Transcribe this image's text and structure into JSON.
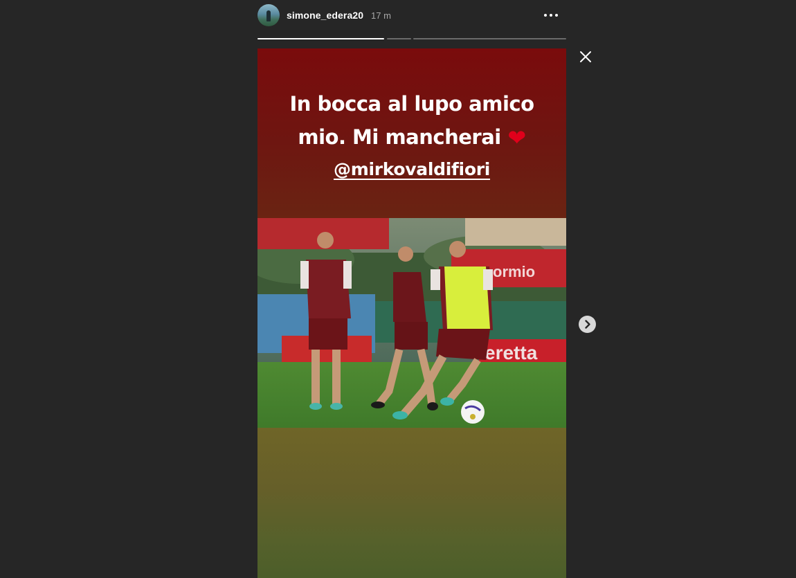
{
  "header": {
    "username": "simone_edera20",
    "timestamp": "17 m",
    "avatar_icon": "profile-avatar",
    "more_icon": "more-options-icon"
  },
  "progress": {
    "segments": [
      {
        "progress": 1.0
      },
      {
        "progress": 0.0
      },
      {
        "progress": 0.0
      }
    ]
  },
  "story": {
    "text_line1": "In bocca al lupo amico",
    "text_line2": "mio. Mi mancherai",
    "heart": "❤",
    "mention": "@mirkovaldifiori",
    "photo_description_icon": "story-photo"
  },
  "controls": {
    "close_icon": "close-icon",
    "next_icon": "chevron-right-icon"
  },
  "colors": {
    "background": "#262626",
    "story_top": "#7a0b0c",
    "heart": "#e0001b"
  }
}
